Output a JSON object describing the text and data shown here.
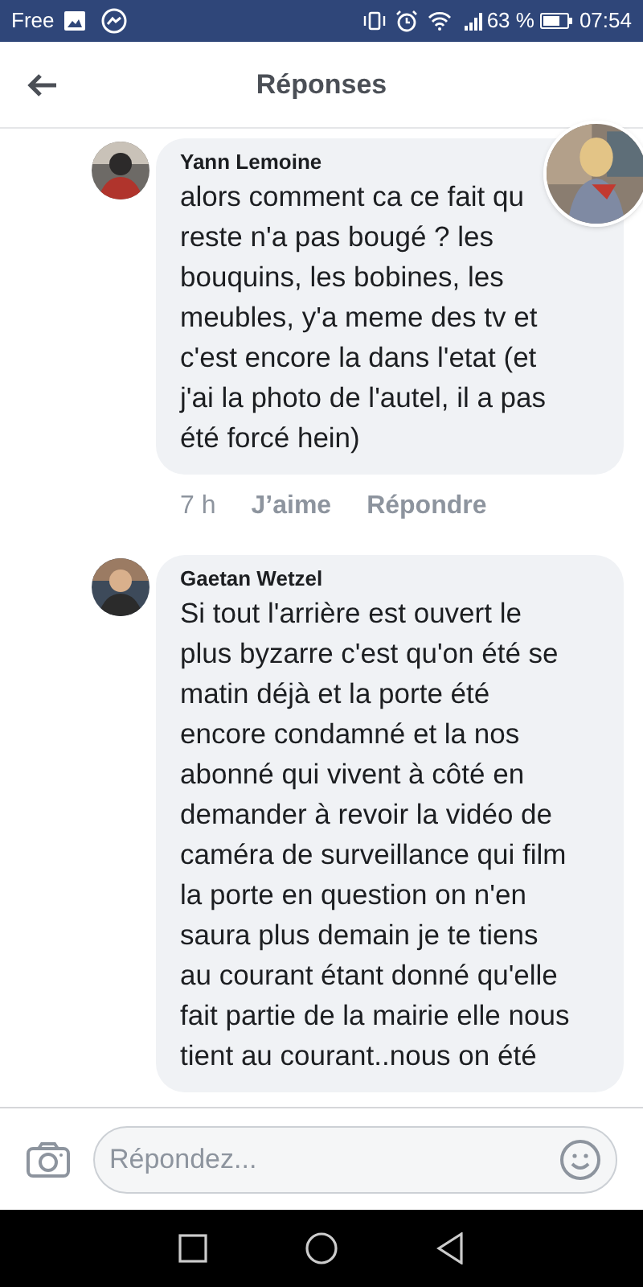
{
  "status_bar": {
    "carrier": "Free",
    "battery_percent": "63 %",
    "time": "07:54"
  },
  "header": {
    "title": "Réponses"
  },
  "comments": [
    {
      "author": "Yann Lemoine",
      "text": "alors comment ca ce fait qu\nreste n'a pas bougé ? les\nbouquins, les bobines, les\nmeubles, y'a meme des tv et\nc'est encore la dans l'etat (et\nj'ai la photo de l'autel, il a pas\nété forcé hein)",
      "time": "7 h",
      "actions": [
        "J’aime",
        "Répondre"
      ]
    },
    {
      "author": "Gaetan Wetzel",
      "text": "Si tout l'arrière est ouvert le\nplus byzarre c'est qu'on été se\nmatin déjà et la porte été\nencore condamné et la nos\nabonné qui vivent à côté en\ndemander à revoir la vidéo de\ncaméra de surveillance qui film\nla porte en question on n'en\nsaura plus demain je te tiens\nau courant étant donné qu'elle\nfait partie de la mairie elle nous\ntient au courant..nous on été"
    }
  ],
  "composer": {
    "placeholder": "Répondez..."
  }
}
